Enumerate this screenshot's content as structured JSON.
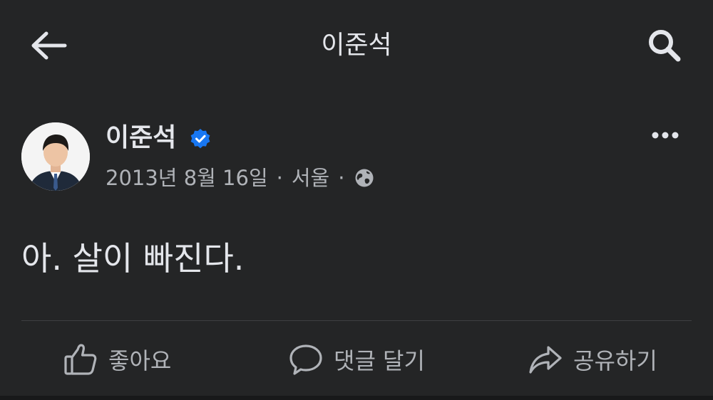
{
  "topbar": {
    "title": "이준석",
    "back_icon": "arrow-left-icon",
    "search_icon": "search-icon"
  },
  "post": {
    "author": "이준석",
    "verified_icon": "verified-badge-icon",
    "date": "2013년 8월 16일",
    "location": "서울",
    "privacy_icon": "globe-icon",
    "separator": "·",
    "more_icon": "more-dots-icon",
    "text": "아. 살이 빠진다."
  },
  "actions": {
    "like_label": "좋아요",
    "comment_label": "댓글 달기",
    "share_label": "공유하기"
  },
  "colors": {
    "background": "#242526",
    "primary_text": "#e4e6eb",
    "secondary_text": "#b0b3b8",
    "verified_blue": "#1877f2"
  }
}
